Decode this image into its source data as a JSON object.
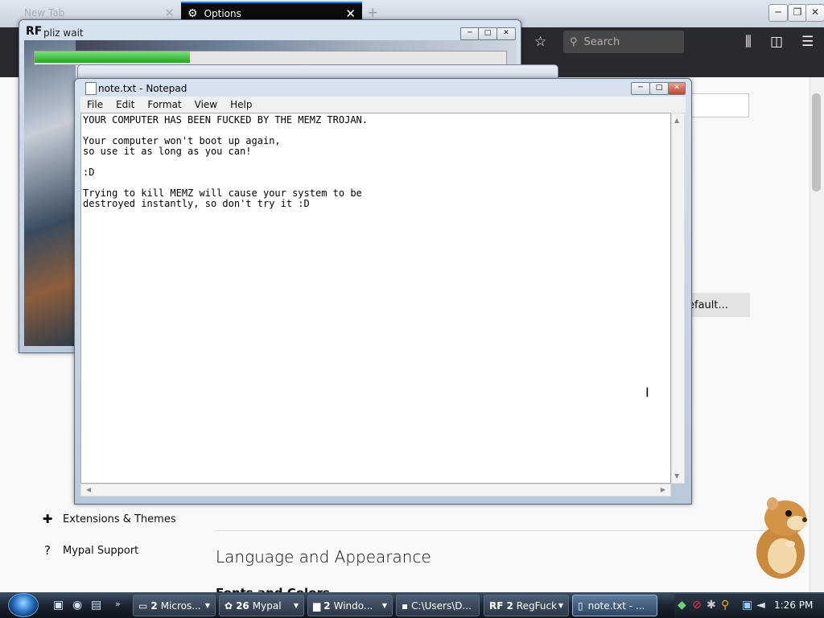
{
  "browser": {
    "tabs": [
      {
        "label": "New Tab",
        "close": "✕"
      },
      {
        "label": "Options",
        "close": "✕"
      }
    ],
    "new_tab": "+",
    "search_placeholder": "Search",
    "default_button_label": "efault...",
    "categories": [
      {
        "icon": "puzzle-icon",
        "label": "Extensions & Themes"
      },
      {
        "icon": "help-icon",
        "label": "Mypal Support"
      }
    ],
    "section_title": "Language and Appearance",
    "section_subtitle": "Fonts and Colors"
  },
  "regfuck_window": {
    "title": "pliz wait",
    "logo": "RF",
    "progress": 0.33
  },
  "notepad": {
    "title": "note.txt - Notepad",
    "menu": [
      "File",
      "Edit",
      "Format",
      "View",
      "Help"
    ],
    "content": "YOUR COMPUTER HAS BEEN FUCKED BY THE MEMZ TROJAN.\n\nYour computer won't boot up again,\nso use it as long as you can!\n\n:D\n\nTrying to kill MEMZ will cause your system to be\ndestroyed instantly, so don't try it :D"
  },
  "taskbar": {
    "buttons": [
      {
        "count": "2",
        "label": "Micros..."
      },
      {
        "count": "26",
        "label": "Mypal"
      },
      {
        "count": "2",
        "label": "Windo..."
      },
      {
        "count": "",
        "label": "C:\\Users\\D..."
      },
      {
        "count": "2",
        "label": "RegFuck"
      },
      {
        "count": "",
        "label": "note.txt - ..."
      }
    ],
    "clock": "1:26 PM"
  }
}
